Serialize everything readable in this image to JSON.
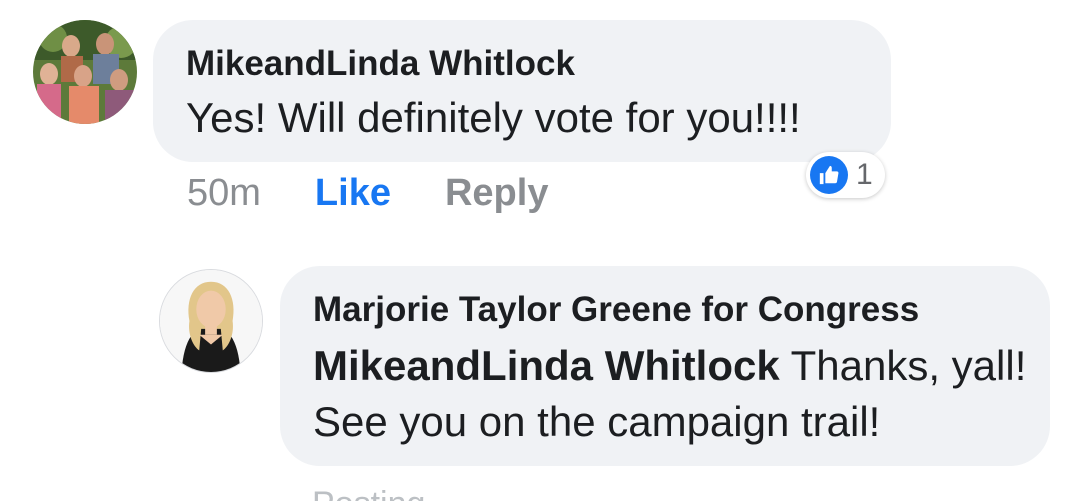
{
  "comment": {
    "author": "MikeandLinda Whitlock",
    "text": "Yes! Will definitely vote for you!!!!",
    "time": "50m",
    "like_label": "Like",
    "reply_label": "Reply",
    "reaction": {
      "icon": "thumbs-up-icon",
      "count": "1",
      "color": "#1877f2"
    }
  },
  "reply": {
    "author": "Marjorie Taylor Greene for Congress",
    "mention": "MikeandLinda Whitlock",
    "text": " Thanks, yall! See you on the campaign trail!",
    "status": "Posting"
  },
  "colors": {
    "bubble": "#f0f2f5",
    "accent": "#1877f2",
    "meta": "#8a8d91"
  }
}
